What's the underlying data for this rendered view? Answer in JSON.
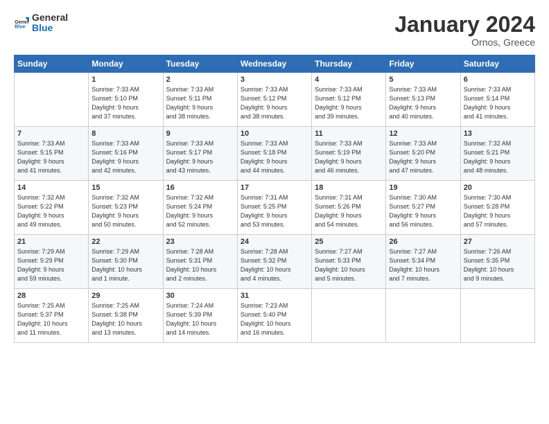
{
  "header": {
    "logo_general": "General",
    "logo_blue": "Blue",
    "title": "January 2024",
    "subtitle": "Ornos, Greece"
  },
  "days_of_week": [
    "Sunday",
    "Monday",
    "Tuesday",
    "Wednesday",
    "Thursday",
    "Friday",
    "Saturday"
  ],
  "weeks": [
    [
      {
        "num": "",
        "info": ""
      },
      {
        "num": "1",
        "info": "Sunrise: 7:33 AM\nSunset: 5:10 PM\nDaylight: 9 hours\nand 37 minutes."
      },
      {
        "num": "2",
        "info": "Sunrise: 7:33 AM\nSunset: 5:11 PM\nDaylight: 9 hours\nand 38 minutes."
      },
      {
        "num": "3",
        "info": "Sunrise: 7:33 AM\nSunset: 5:12 PM\nDaylight: 9 hours\nand 38 minutes."
      },
      {
        "num": "4",
        "info": "Sunrise: 7:33 AM\nSunset: 5:12 PM\nDaylight: 9 hours\nand 39 minutes."
      },
      {
        "num": "5",
        "info": "Sunrise: 7:33 AM\nSunset: 5:13 PM\nDaylight: 9 hours\nand 40 minutes."
      },
      {
        "num": "6",
        "info": "Sunrise: 7:33 AM\nSunset: 5:14 PM\nDaylight: 9 hours\nand 41 minutes."
      }
    ],
    [
      {
        "num": "7",
        "info": "Sunrise: 7:33 AM\nSunset: 5:15 PM\nDaylight: 9 hours\nand 41 minutes."
      },
      {
        "num": "8",
        "info": "Sunrise: 7:33 AM\nSunset: 5:16 PM\nDaylight: 9 hours\nand 42 minutes."
      },
      {
        "num": "9",
        "info": "Sunrise: 7:33 AM\nSunset: 5:17 PM\nDaylight: 9 hours\nand 43 minutes."
      },
      {
        "num": "10",
        "info": "Sunrise: 7:33 AM\nSunset: 5:18 PM\nDaylight: 9 hours\nand 44 minutes."
      },
      {
        "num": "11",
        "info": "Sunrise: 7:33 AM\nSunset: 5:19 PM\nDaylight: 9 hours\nand 46 minutes."
      },
      {
        "num": "12",
        "info": "Sunrise: 7:33 AM\nSunset: 5:20 PM\nDaylight: 9 hours\nand 47 minutes."
      },
      {
        "num": "13",
        "info": "Sunrise: 7:32 AM\nSunset: 5:21 PM\nDaylight: 9 hours\nand 48 minutes."
      }
    ],
    [
      {
        "num": "14",
        "info": "Sunrise: 7:32 AM\nSunset: 5:22 PM\nDaylight: 9 hours\nand 49 minutes."
      },
      {
        "num": "15",
        "info": "Sunrise: 7:32 AM\nSunset: 5:23 PM\nDaylight: 9 hours\nand 50 minutes."
      },
      {
        "num": "16",
        "info": "Sunrise: 7:32 AM\nSunset: 5:24 PM\nDaylight: 9 hours\nand 52 minutes."
      },
      {
        "num": "17",
        "info": "Sunrise: 7:31 AM\nSunset: 5:25 PM\nDaylight: 9 hours\nand 53 minutes."
      },
      {
        "num": "18",
        "info": "Sunrise: 7:31 AM\nSunset: 5:26 PM\nDaylight: 9 hours\nand 54 minutes."
      },
      {
        "num": "19",
        "info": "Sunrise: 7:30 AM\nSunset: 5:27 PM\nDaylight: 9 hours\nand 56 minutes."
      },
      {
        "num": "20",
        "info": "Sunrise: 7:30 AM\nSunset: 5:28 PM\nDaylight: 9 hours\nand 57 minutes."
      }
    ],
    [
      {
        "num": "21",
        "info": "Sunrise: 7:29 AM\nSunset: 5:29 PM\nDaylight: 9 hours\nand 59 minutes."
      },
      {
        "num": "22",
        "info": "Sunrise: 7:29 AM\nSunset: 5:30 PM\nDaylight: 10 hours\nand 1 minute."
      },
      {
        "num": "23",
        "info": "Sunrise: 7:28 AM\nSunset: 5:31 PM\nDaylight: 10 hours\nand 2 minutes."
      },
      {
        "num": "24",
        "info": "Sunrise: 7:28 AM\nSunset: 5:32 PM\nDaylight: 10 hours\nand 4 minutes."
      },
      {
        "num": "25",
        "info": "Sunrise: 7:27 AM\nSunset: 5:33 PM\nDaylight: 10 hours\nand 5 minutes."
      },
      {
        "num": "26",
        "info": "Sunrise: 7:27 AM\nSunset: 5:34 PM\nDaylight: 10 hours\nand 7 minutes."
      },
      {
        "num": "27",
        "info": "Sunrise: 7:26 AM\nSunset: 5:35 PM\nDaylight: 10 hours\nand 9 minutes."
      }
    ],
    [
      {
        "num": "28",
        "info": "Sunrise: 7:25 AM\nSunset: 5:37 PM\nDaylight: 10 hours\nand 11 minutes."
      },
      {
        "num": "29",
        "info": "Sunrise: 7:25 AM\nSunset: 5:38 PM\nDaylight: 10 hours\nand 13 minutes."
      },
      {
        "num": "30",
        "info": "Sunrise: 7:24 AM\nSunset: 5:39 PM\nDaylight: 10 hours\nand 14 minutes."
      },
      {
        "num": "31",
        "info": "Sunrise: 7:23 AM\nSunset: 5:40 PM\nDaylight: 10 hours\nand 16 minutes."
      },
      {
        "num": "",
        "info": ""
      },
      {
        "num": "",
        "info": ""
      },
      {
        "num": "",
        "info": ""
      }
    ]
  ]
}
